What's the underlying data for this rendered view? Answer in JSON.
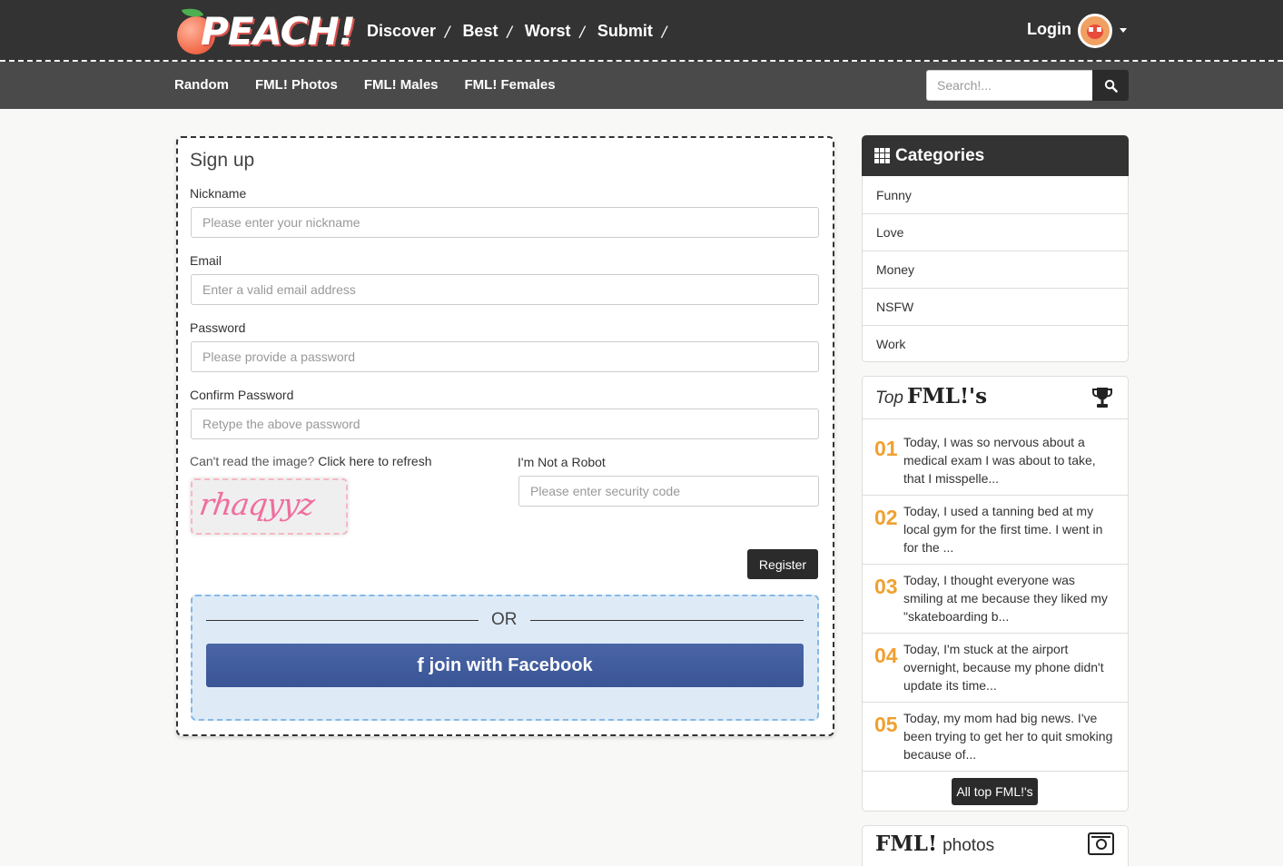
{
  "header": {
    "logo_text": "PEACH!",
    "nav": [
      "Discover",
      "Best",
      "Worst",
      "Submit"
    ],
    "separator": "/",
    "login_label": "Login"
  },
  "subnav": {
    "items": [
      "Random",
      "FML! Photos",
      "FML! Males",
      "FML! Females"
    ],
    "search_placeholder": "Search!..."
  },
  "signup": {
    "title": "Sign up",
    "nickname": {
      "label": "Nickname",
      "placeholder": "Please enter your nickname"
    },
    "email": {
      "label": "Email",
      "placeholder": "Enter a valid email address"
    },
    "password": {
      "label": "Password",
      "placeholder": "Please provide a password"
    },
    "confirm": {
      "label": "Confirm Password",
      "placeholder": "Retype the above password"
    },
    "captcha_hint": "Can't read the image?",
    "captcha_refresh": "Click here to refresh",
    "captcha_text": "rhaqyyz",
    "robot": {
      "label": "I'm Not a Robot",
      "placeholder": "Please enter security code"
    },
    "register_label": "Register",
    "or_label": "OR",
    "facebook_label": "join with Facebook"
  },
  "categories": {
    "title": "Categories",
    "items": [
      "Funny",
      "Love",
      "Money",
      "NSFW",
      "Work"
    ]
  },
  "top_fmls": {
    "title_top": "Top",
    "title_fml": "FML!'s",
    "items": [
      {
        "num": "01",
        "text": "Today, I was so nervous about a medical exam I was about to take, that I misspelle..."
      },
      {
        "num": "02",
        "text": "Today, I used a tanning bed at my local gym for the first time. I went in for the ..."
      },
      {
        "num": "03",
        "text": "Today, I thought everyone was smiling at me because they liked my \"skateboarding b..."
      },
      {
        "num": "04",
        "text": "Today, I'm stuck at the airport overnight, because my phone didn't update its time..."
      },
      {
        "num": "05",
        "text": "Today, my mom had big news. I've been trying to get her to quit smoking because of..."
      }
    ],
    "all_label": "All top FML!'s"
  },
  "photos": {
    "title_fml": "FML!",
    "title_rest": "photos"
  },
  "colors": {
    "topbar": "#333333",
    "subbar": "#4a4a4a",
    "accent_orange": "#f0a030",
    "facebook": "#3b5998"
  }
}
